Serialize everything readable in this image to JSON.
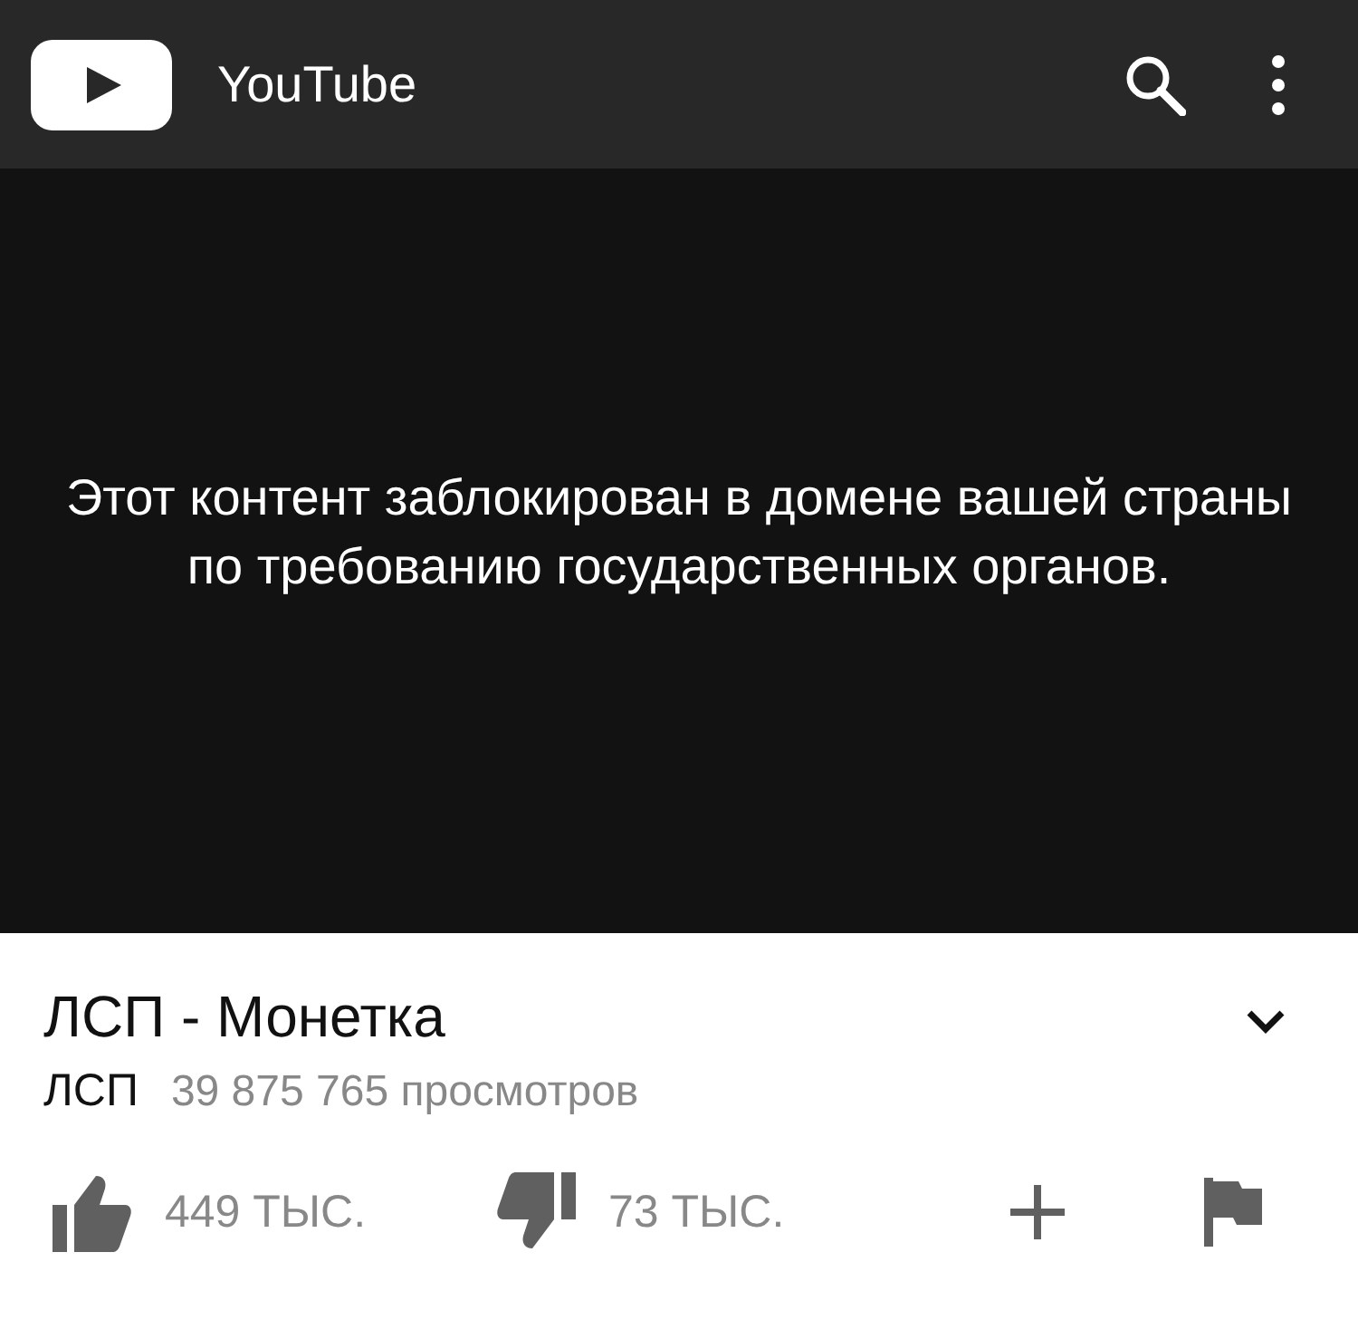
{
  "header": {
    "title": "YouTube"
  },
  "player": {
    "message": "Этот контент заблокирован в домене вашей страны по требованию государственных органов."
  },
  "video": {
    "title": "ЛСП - Монетка",
    "channel": "ЛСП",
    "views": "39 875 765 просмотров"
  },
  "actions": [
    {
      "kind": "like",
      "label": "449 ТЫС."
    },
    {
      "kind": "dislike",
      "label": "73 ТЫС."
    },
    {
      "kind": "add"
    },
    {
      "kind": "flag"
    }
  ]
}
